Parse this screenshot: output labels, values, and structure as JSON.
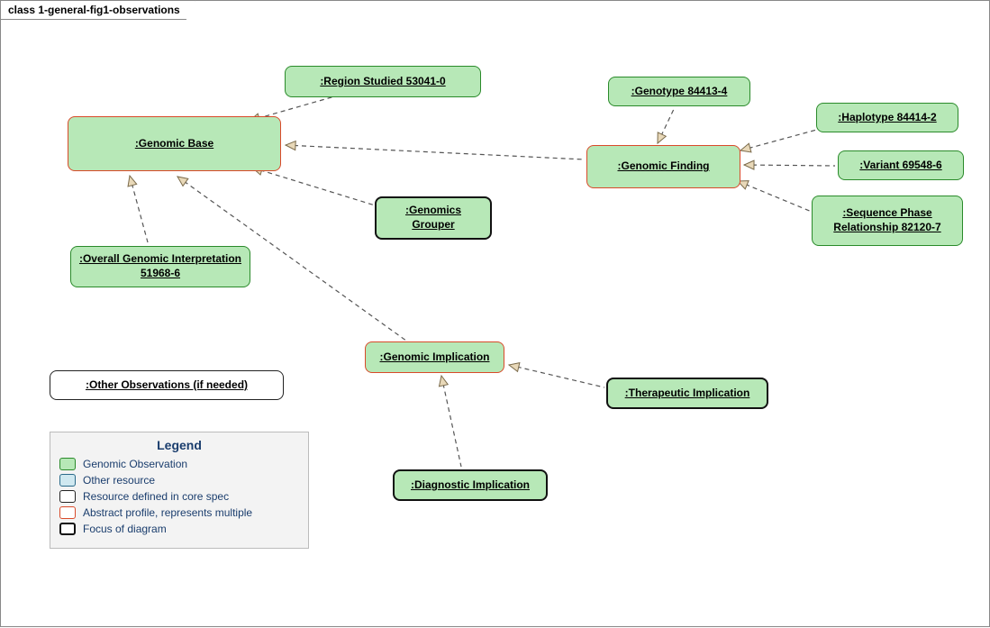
{
  "frame_title": "class 1-general-fig1-observations",
  "nodes": {
    "genomic_base": ":Genomic Base",
    "region_studied": ":Region Studied 53041-0",
    "overall_interp": ":Overall Genomic Interpretation 51968-6",
    "genomics_grouper": ":Genomics Grouper",
    "genomic_finding": ":Genomic Finding",
    "genotype": ":Genotype  84413-4",
    "haplotype": ":Haplotype 84414-2",
    "variant": ":Variant 69548-6",
    "sequence_phase": ":Sequence Phase Relationship 82120-7",
    "genomic_implication": ":Genomic Implication",
    "therapeutic_impl": ":Therapeutic Implication",
    "diagnostic_impl": ":Diagnostic Implication",
    "other_obs": ":Other Observations (if needed)"
  },
  "legend": {
    "title": "Legend",
    "items": [
      "Genomic Observation",
      "Other resource",
      "Resource defined in core spec",
      "Abstract profile, represents multiple",
      "Focus of diagram"
    ]
  }
}
